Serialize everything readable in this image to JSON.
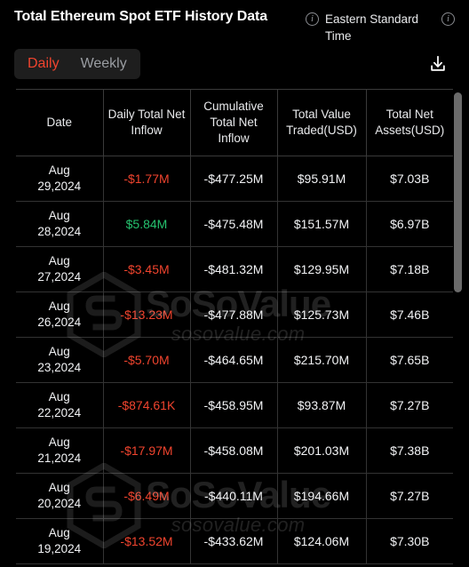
{
  "header": {
    "title": "Total Ethereum Spot ETF History Data",
    "timezone": "Eastern Standard Time",
    "info_icon_glyph": "i",
    "download_icon_name": "download-icon"
  },
  "toggle": {
    "active": "Daily",
    "inactive": "Weekly"
  },
  "table": {
    "columns": [
      "Date",
      "Daily Total Net Inflow",
      "Cumulative Total Net Inflow",
      "Total Value Traded(USD)",
      "Total Net Assets(USD)"
    ],
    "rows": [
      {
        "date_month": "Aug",
        "date_day": "29,2024",
        "daily_net_inflow": "-$1.77M",
        "daily_sign": "neg",
        "cumulative_net_inflow": "-$477.25M",
        "total_value_traded": "$95.91M",
        "total_net_assets": "$7.03B"
      },
      {
        "date_month": "Aug",
        "date_day": "28,2024",
        "daily_net_inflow": "$5.84M",
        "daily_sign": "pos",
        "cumulative_net_inflow": "-$475.48M",
        "total_value_traded": "$151.57M",
        "total_net_assets": "$6.97B"
      },
      {
        "date_month": "Aug",
        "date_day": "27,2024",
        "daily_net_inflow": "-$3.45M",
        "daily_sign": "neg",
        "cumulative_net_inflow": "-$481.32M",
        "total_value_traded": "$129.95M",
        "total_net_assets": "$7.18B"
      },
      {
        "date_month": "Aug",
        "date_day": "26,2024",
        "daily_net_inflow": "-$13.23M",
        "daily_sign": "neg",
        "cumulative_net_inflow": "-$477.88M",
        "total_value_traded": "$125.73M",
        "total_net_assets": "$7.46B"
      },
      {
        "date_month": "Aug",
        "date_day": "23,2024",
        "daily_net_inflow": "-$5.70M",
        "daily_sign": "neg",
        "cumulative_net_inflow": "-$464.65M",
        "total_value_traded": "$215.70M",
        "total_net_assets": "$7.65B"
      },
      {
        "date_month": "Aug",
        "date_day": "22,2024",
        "daily_net_inflow": "-$874.61K",
        "daily_sign": "neg",
        "cumulative_net_inflow": "-$458.95M",
        "total_value_traded": "$93.87M",
        "total_net_assets": "$7.27B"
      },
      {
        "date_month": "Aug",
        "date_day": "21,2024",
        "daily_net_inflow": "-$17.97M",
        "daily_sign": "neg",
        "cumulative_net_inflow": "-$458.08M",
        "total_value_traded": "$201.03M",
        "total_net_assets": "$7.38B"
      },
      {
        "date_month": "Aug",
        "date_day": "20,2024",
        "daily_net_inflow": "-$6.49M",
        "daily_sign": "neg",
        "cumulative_net_inflow": "-$440.11M",
        "total_value_traded": "$194.66M",
        "total_net_assets": "$7.27B"
      },
      {
        "date_month": "Aug",
        "date_day": "19,2024",
        "daily_net_inflow": "-$13.52M",
        "daily_sign": "neg",
        "cumulative_net_inflow": "-$433.62M",
        "total_value_traded": "$124.06M",
        "total_net_assets": "$7.30B"
      }
    ]
  },
  "watermark": {
    "brand": "SoSoValue",
    "domain": "sosovalue.com"
  },
  "colors": {
    "background": "#000000",
    "negative": "#f0442e",
    "positive": "#25c26e",
    "accent": "#f0442e",
    "text": "#f2f3f5",
    "border": "#333333",
    "toggle_background": "#1e1e1e",
    "scrollbar": "#6b6b6b"
  }
}
